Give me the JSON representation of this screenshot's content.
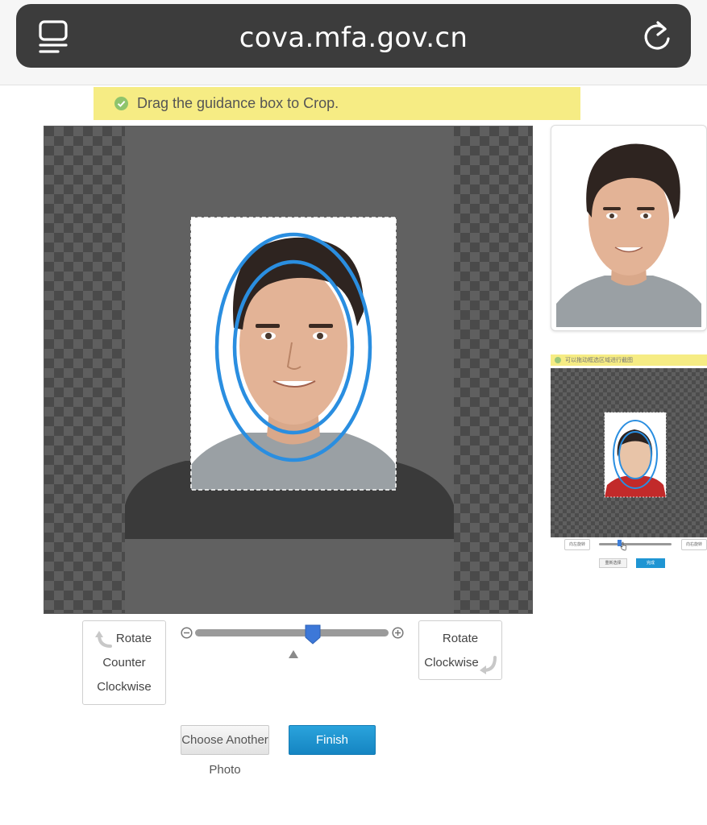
{
  "browser": {
    "url": "cova.mfa.gov.cn",
    "tabs_icon": "tabs-icon",
    "reload_icon": "reload-icon"
  },
  "hint": {
    "icon": "check-circle-icon",
    "text": "Drag the guidance box to Crop."
  },
  "crop": {
    "photo_alt": "passport portrait of a man",
    "guidance_icon": "face-oval-guide-icon"
  },
  "demo": {
    "hint_text": "可以拖动框选区域进行截图",
    "rotate_left_label": "向左旋转",
    "rotate_right_label": "向右旋转",
    "choose_label": "重新选择",
    "finish_label": "完成"
  },
  "controls": {
    "rotate_ccw": {
      "line1": "Rotate",
      "line2": "Counter",
      "line3": "Clockwise",
      "icon": "rotate-ccw-arrow-icon"
    },
    "rotate_cw": {
      "line1": "Rotate",
      "line2": "Clockwise",
      "icon": "rotate-cw-arrow-icon"
    },
    "zoom": {
      "level": 0.61,
      "minus_icon": "zoom-minus-icon",
      "plus_icon": "zoom-plus-icon"
    },
    "choose_another_line1": "Choose Another",
    "choose_another_line2": "Photo",
    "finish": "Finish"
  },
  "colors": {
    "accent_blue": "#1f95d3",
    "guide_blue": "#2a8ee0",
    "hint_yellow": "#f6ec84"
  }
}
